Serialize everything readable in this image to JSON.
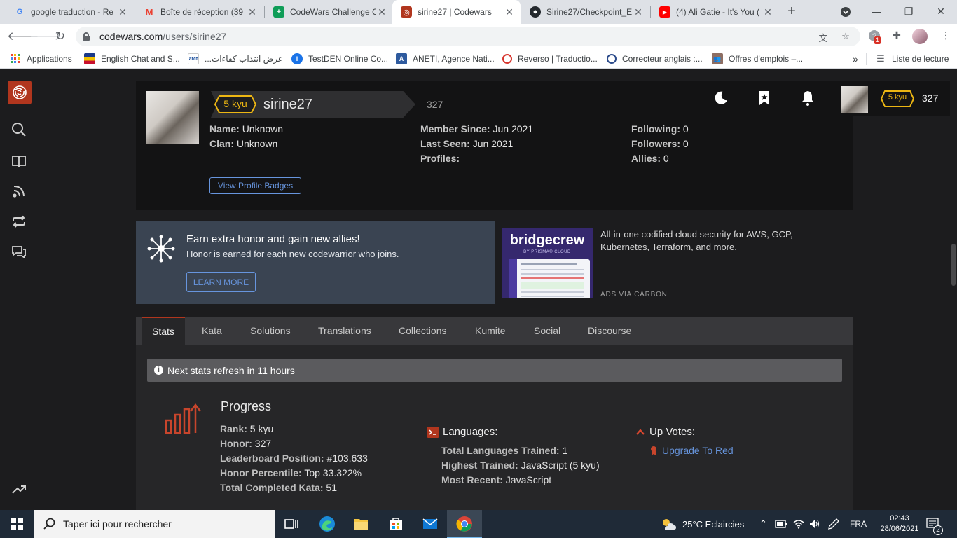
{
  "browser": {
    "tabs": [
      {
        "title": "google traduction - Re",
        "favicon": "google-icon",
        "color": "#4285f4"
      },
      {
        "title": "Boîte de réception (39",
        "favicon": "gmail-icon",
        "color": "#ea4335"
      },
      {
        "title": "CodeWars Challenge C",
        "favicon": "sheets-icon",
        "color": "#0f9d58"
      },
      {
        "title": "sirine27 | Codewars",
        "favicon": "codewars-icon",
        "color": "#b1361e"
      },
      {
        "title": "Sirine27/Checkpoint_E",
        "favicon": "github-icon",
        "color": "#24292e"
      },
      {
        "title": "(4) Ali Gatie - It's You (",
        "favicon": "youtube-icon",
        "color": "#ff0000"
      }
    ],
    "url_domain": "codewars.com",
    "url_path": "/users/sirine27",
    "extension_badge": "1",
    "bookmarks": [
      {
        "label": "Applications",
        "icon": "apps-grid-icon",
        "color": "#4285f4"
      },
      {
        "label": "English Chat and S...",
        "icon": "flag-icon",
        "color": "#c8102e"
      },
      {
        "label": "عرض انتداب كفاءات...",
        "icon": "atct-icon",
        "color": "#1b4f9c"
      },
      {
        "label": "TestDEN Online Co...",
        "icon": "info-icon",
        "color": "#1a73e8"
      },
      {
        "label": "ANETI, Agence Nati...",
        "icon": "aneti-icon",
        "color": "#2e5a9e"
      },
      {
        "label": "Reverso | Traductio...",
        "icon": "reverso-icon",
        "color": "#d6352d"
      },
      {
        "label": "Correcteur anglais :...",
        "icon": "scribens-icon",
        "color": "#2b4a8a"
      },
      {
        "label": "Offres d'emplois –...",
        "icon": "people-icon",
        "color": "#8d6e63"
      }
    ],
    "reading_list": "Liste de lecture"
  },
  "profile": {
    "kyu": "5 kyu",
    "username": "sirine27",
    "honor": "327",
    "col1": [
      {
        "label": "Name:",
        "value": "Unknown"
      },
      {
        "label": "Clan:",
        "value": "Unknown"
      }
    ],
    "col2": [
      {
        "label": "Member Since:",
        "value": "Jun 2021"
      },
      {
        "label": "Last Seen:",
        "value": "Jun 2021"
      },
      {
        "label": "Profiles:",
        "value": ""
      }
    ],
    "col3": [
      {
        "label": "Following:",
        "value": "0"
      },
      {
        "label": "Followers:",
        "value": "0"
      },
      {
        "label": "Allies:",
        "value": "0"
      }
    ],
    "badges_button": "View Profile Badges"
  },
  "topbar": {
    "kyu": "5 kyu",
    "honor": "327"
  },
  "banner": {
    "title": "Earn extra honor and gain new allies!",
    "subtitle": "Honor is earned for each new codewarrior who joins.",
    "button": "LEARN MORE"
  },
  "ad": {
    "brand": "bridgecrew",
    "brand_sub": "BY PRISMA® CLOUD",
    "text": "All-in-one codified cloud security for AWS, GCP, Kubernetes, Terraform, and more.",
    "via": "ADS VIA CARBON"
  },
  "profile_tabs": [
    "Stats",
    "Kata",
    "Solutions",
    "Translations",
    "Collections",
    "Kumite",
    "Social",
    "Discourse"
  ],
  "stats": {
    "refresh_notice": "Next stats refresh in 11 hours",
    "progress_title": "Progress",
    "progress": [
      {
        "label": "Rank:",
        "value": "5 kyu"
      },
      {
        "label": "Honor:",
        "value": "327"
      },
      {
        "label": "Leaderboard Position:",
        "value": "#103,633"
      },
      {
        "label": "Honor Percentile:",
        "value": "Top 33.322%"
      },
      {
        "label": "Total Completed Kata:",
        "value": "51"
      }
    ],
    "languages_title": "Languages:",
    "languages": [
      {
        "label": "Total Languages Trained:",
        "value": "1"
      },
      {
        "label": "Highest Trained:",
        "value": "JavaScript (5 kyu)"
      },
      {
        "label": "Most Recent:",
        "value": "JavaScript"
      }
    ],
    "upvotes_title": "Up Votes:",
    "upvotes_link": "Upgrade To Red"
  },
  "taskbar": {
    "search_placeholder": "Taper ici pour rechercher",
    "weather": "25°C  Eclaircies",
    "lang": "FRA",
    "time": "02:43",
    "date": "28/06/2021",
    "notifications": "2"
  },
  "colors": {
    "codewars_red": "#b1361e",
    "kyu_yellow": "#ecb613",
    "link_blue": "#6795de"
  }
}
